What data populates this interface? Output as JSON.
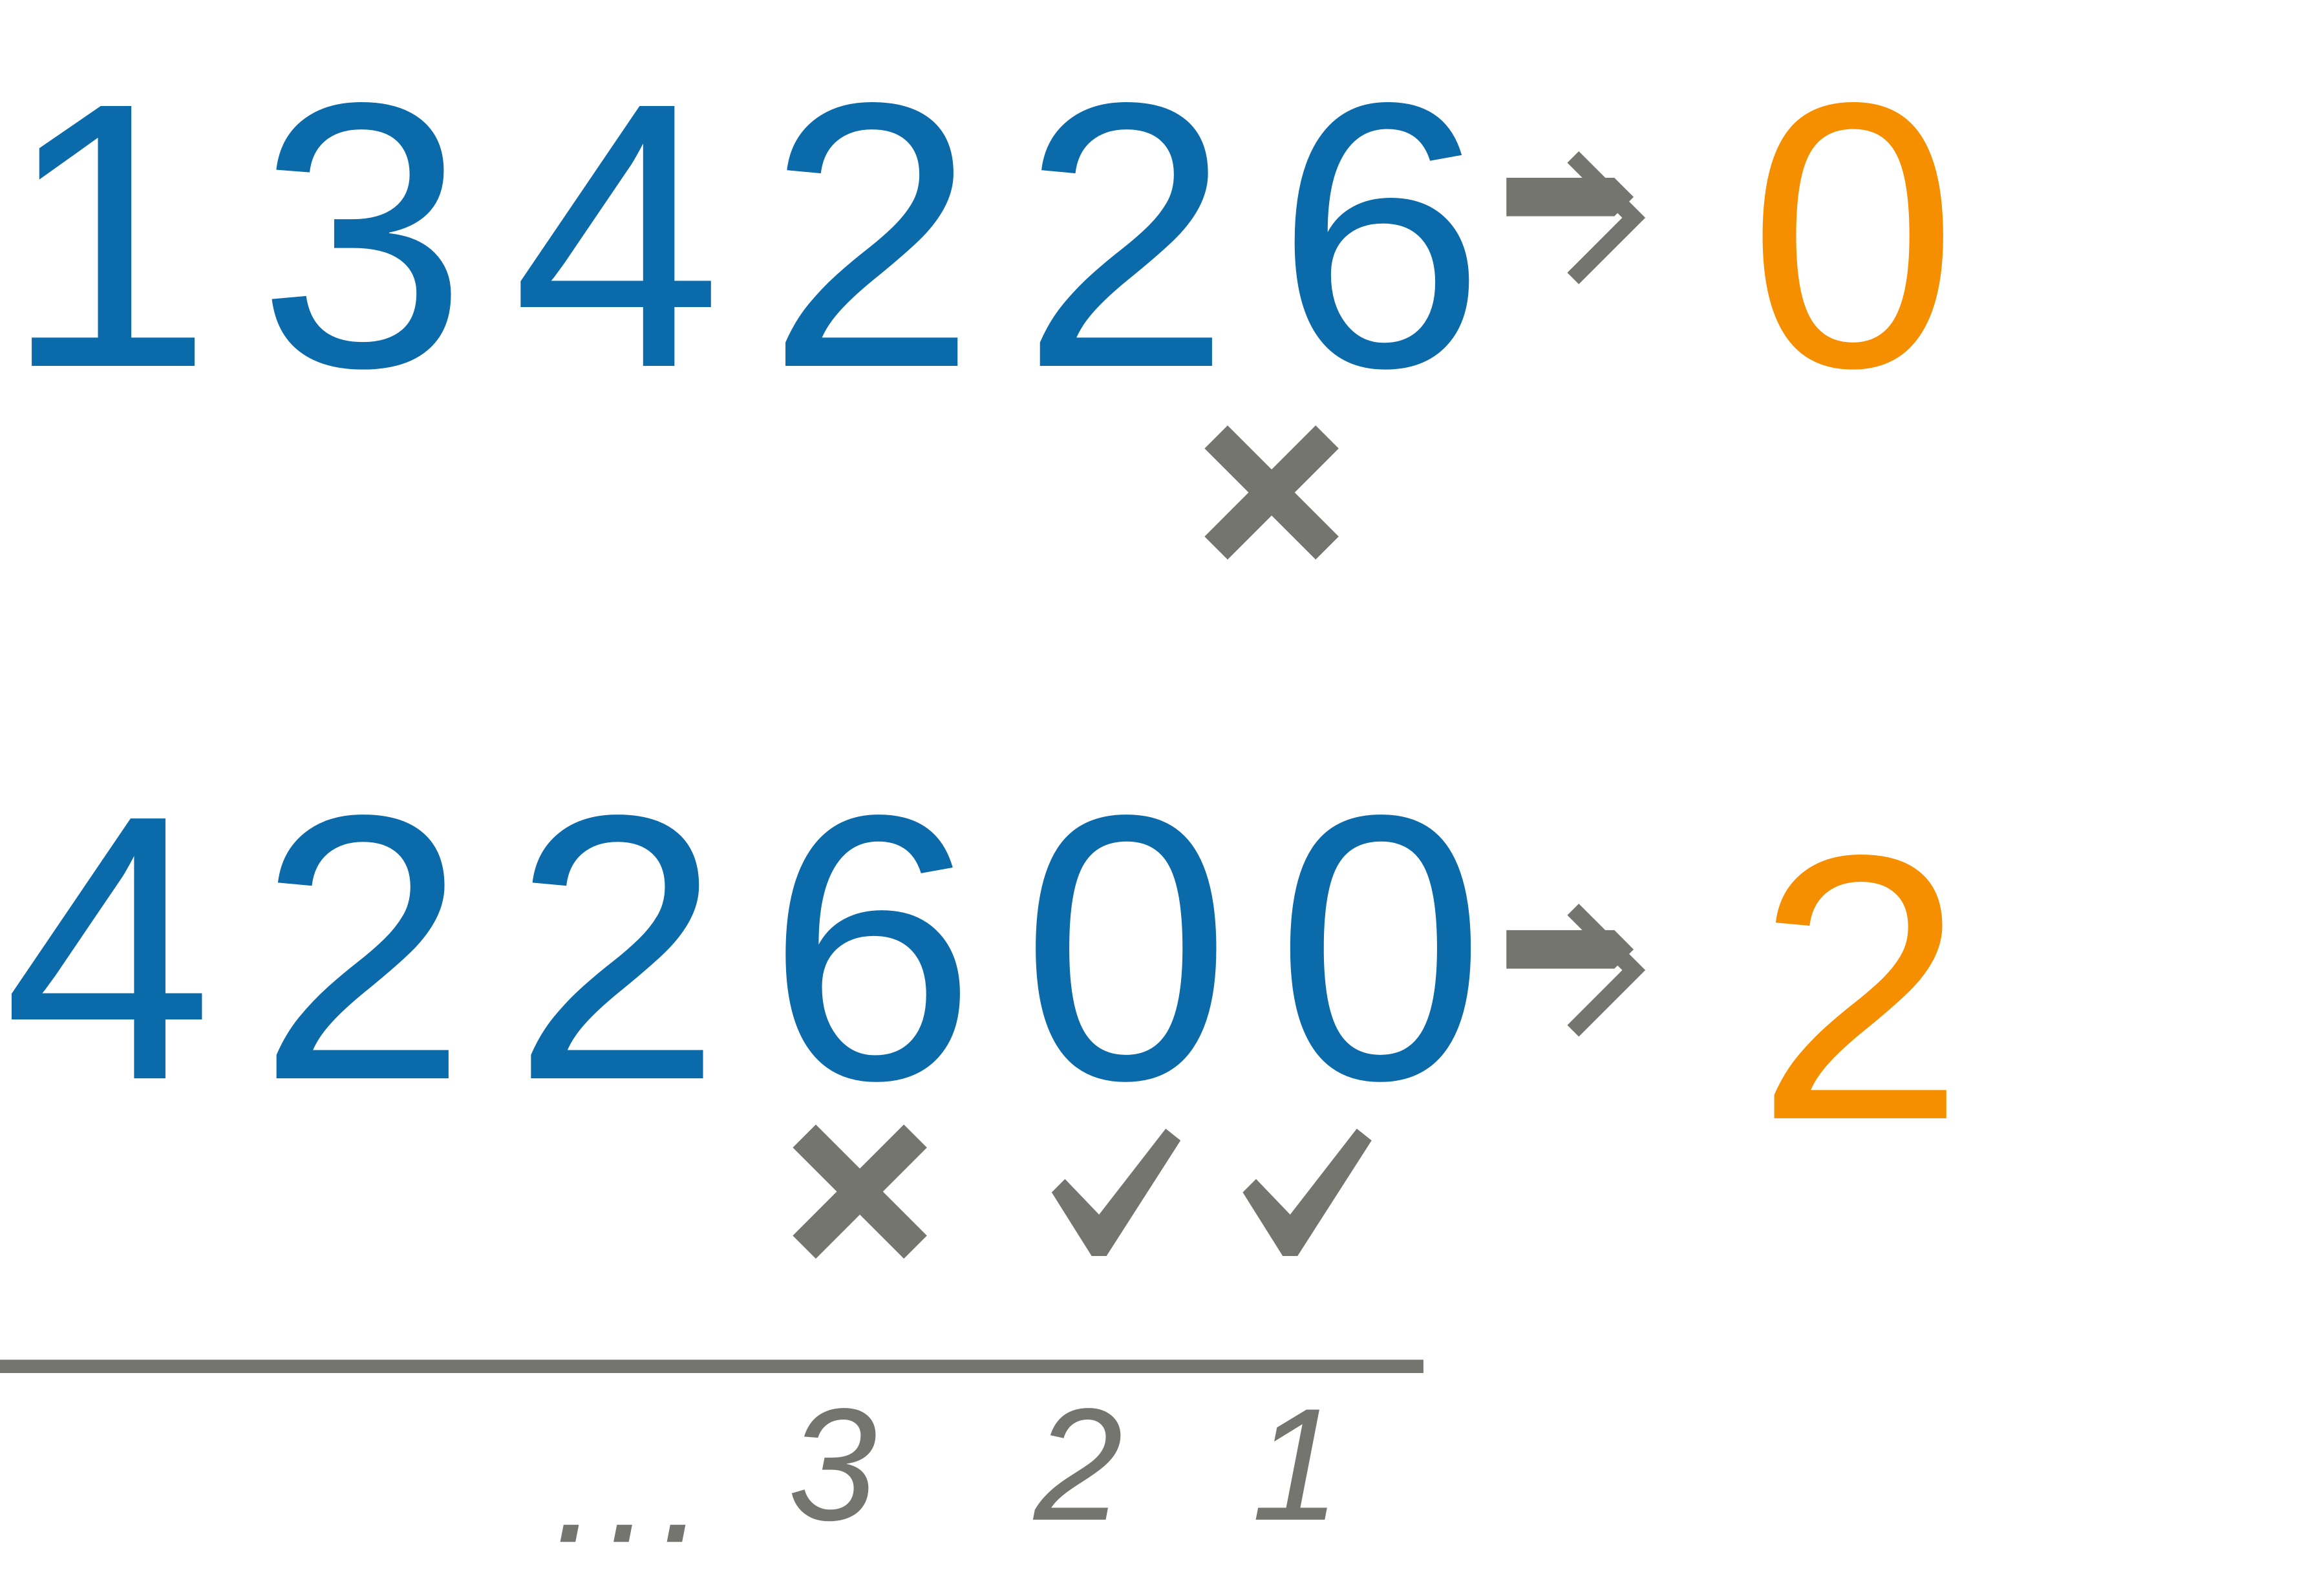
{
  "colors": {
    "number": "#0b6aa9",
    "result": "#f58f00",
    "marks": "#757570"
  },
  "row1": {
    "number": "134226",
    "arrow_icon": "implies-arrow-icon",
    "result": "0",
    "digit_marks": [
      "cross"
    ]
  },
  "row2": {
    "number": "422600",
    "arrow_icon": "implies-arrow-icon",
    "result": "2",
    "digit_marks": [
      "cross",
      "check",
      "check"
    ]
  },
  "position_index": {
    "ellipsis": "...",
    "labels": [
      "3",
      "2",
      "1"
    ]
  }
}
